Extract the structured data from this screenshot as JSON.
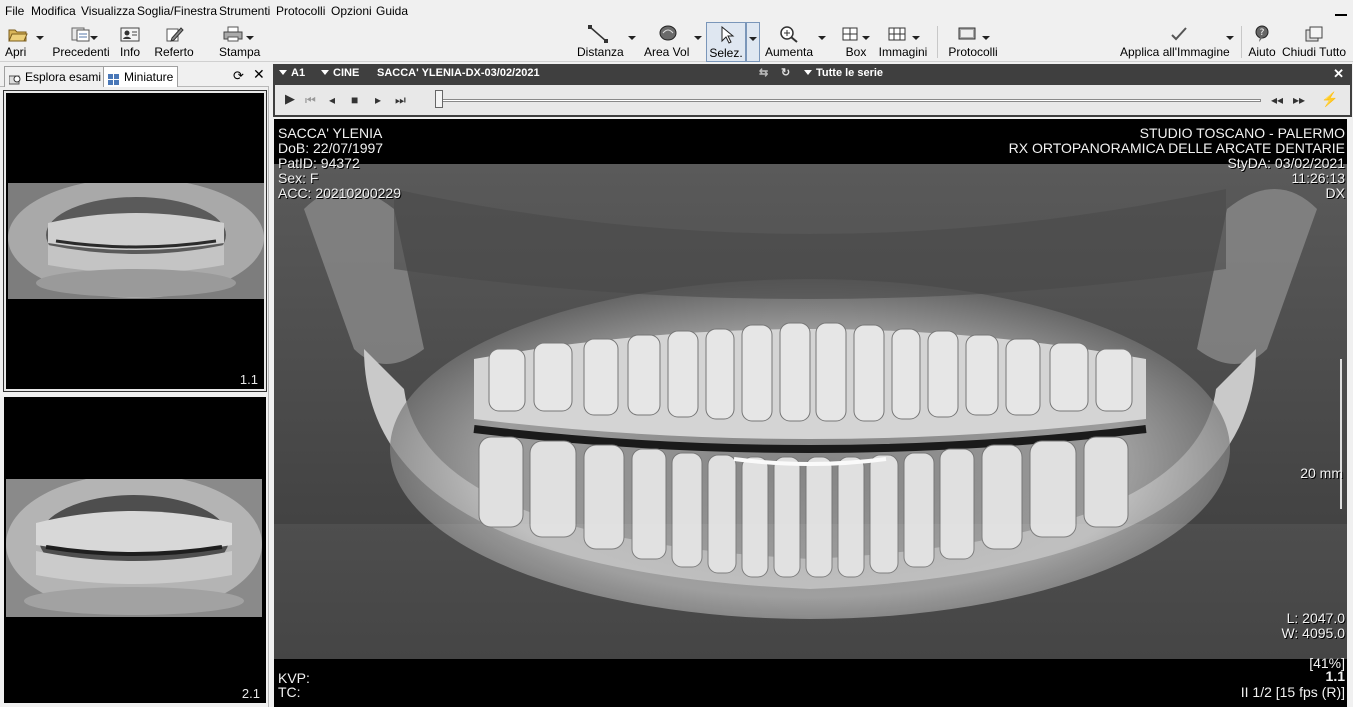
{
  "menu": [
    "File",
    "Modifica",
    "Visualizza",
    "Soglia/Finestra",
    "Strumenti",
    "Protocolli",
    "Opzioni",
    "Guida"
  ],
  "toolbar": {
    "apri": "Apri",
    "precedenti": "Precedenti",
    "info": "Info",
    "referto": "Referto",
    "stampa": "Stampa",
    "distanza": "Distanza",
    "area_vol": "Area Vol",
    "selez": "Selez.",
    "aumenta": "Aumenta",
    "box": "Box",
    "immagini": "Immagini",
    "protocolli": "Protocolli",
    "applica": "Applica all'Immagine",
    "aiuto": "Aiuto",
    "chiudi_tutto": "Chiudi Tutto"
  },
  "left_panel": {
    "tab_esplora": "Esplora esami",
    "tab_miniature": "Miniature",
    "thumbs": [
      {
        "label": "1.1"
      },
      {
        "label": "2.1"
      }
    ]
  },
  "viewer": {
    "layout": "A1",
    "cine": "CINE",
    "title": "SACCA' YLENIA-DX-03/02/2021",
    "series": "Tutte le serie",
    "overlay": {
      "name": "SACCA' YLENIA",
      "dob": "DoB: 22/07/1997",
      "patid": "PatID: 94372",
      "sex": "Sex: F",
      "acc": "ACC: 20210200229",
      "studio": "STUDIO TOSCANO - PALERMO",
      "exam": "RX ORTOPANORAMICA DELLE ARCATE DENTARIE",
      "stydate": "StyDA: 03/02/2021",
      "time": "11:26:13",
      "side": "DX",
      "scale": "20 mm",
      "level": "L: 2047.0",
      "width": "W: 4095.0",
      "zoom": "[41%]",
      "series_num": "1.1",
      "kvp": "KVP:",
      "tc": "TC:",
      "frames": "II 1/2 [15 fps (R)]"
    }
  }
}
